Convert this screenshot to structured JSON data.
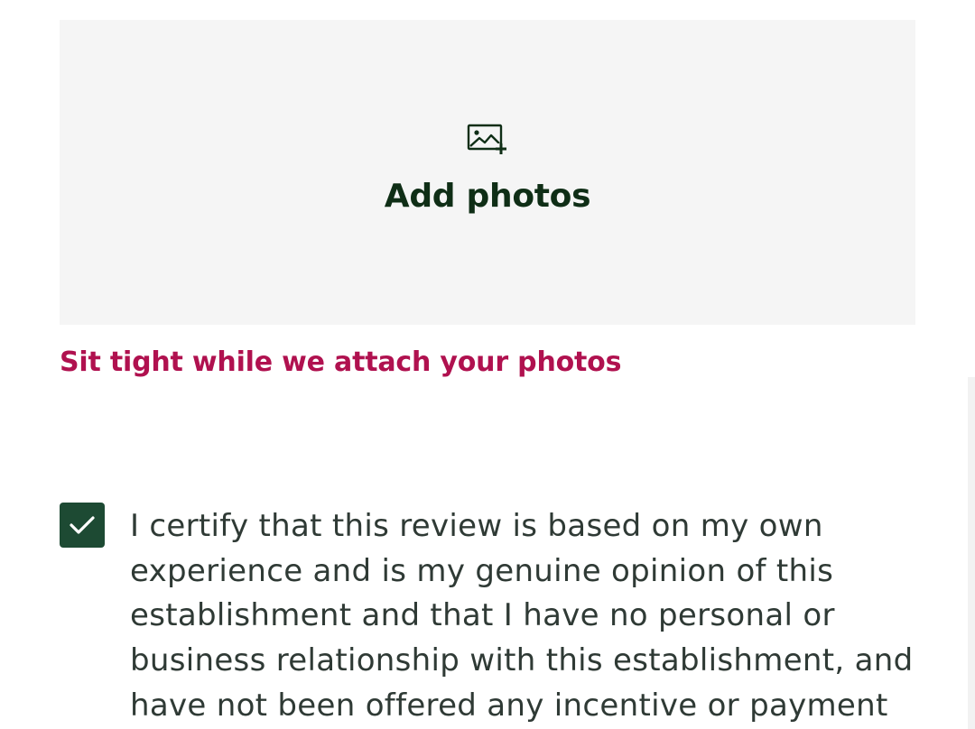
{
  "upload": {
    "label": "Add photos",
    "icon": "add-photo-icon"
  },
  "status": {
    "message": "Sit tight while we attach your photos",
    "color": "#b0114f"
  },
  "certification": {
    "checked": true,
    "text": "I certify that this review is based on my own experience and is my genuine opinion of this establishment and that I have no personal or business relationship with this establishment, and have not been offered any incentive or payment"
  },
  "colors": {
    "checkbox": "#1d4a33",
    "heading": "#0f2e16",
    "dropzone_bg": "#f5f5f5"
  }
}
